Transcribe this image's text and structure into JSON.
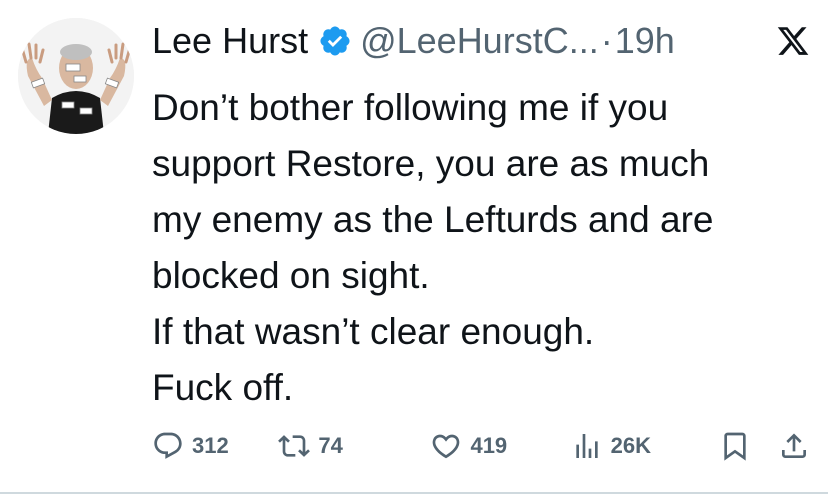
{
  "author": {
    "display_name": "Lee Hurst",
    "handle": "@LeeHurstC...",
    "separator": "·",
    "time": "19h"
  },
  "tweet": {
    "lines": [
      "Don’t bother following me if you",
      "support Restore, you are as much",
      "my enemy as the Lefturds and are",
      "blocked on sight.",
      "If that wasn’t clear enough.",
      "Fuck off."
    ]
  },
  "actions": {
    "replies": "312",
    "retweets": "74",
    "likes": "419",
    "views": "26K"
  },
  "icons": {
    "verified": "verified-badge-icon",
    "platform": "x-logo-icon",
    "reply": "reply-icon",
    "retweet": "retweet-icon",
    "like": "heart-icon",
    "views": "views-chart-icon",
    "bookmark": "bookmark-icon",
    "share": "share-icon"
  },
  "colors": {
    "text": "#0f1419",
    "secondary": "#536471",
    "verified": "#1d9bf0"
  }
}
